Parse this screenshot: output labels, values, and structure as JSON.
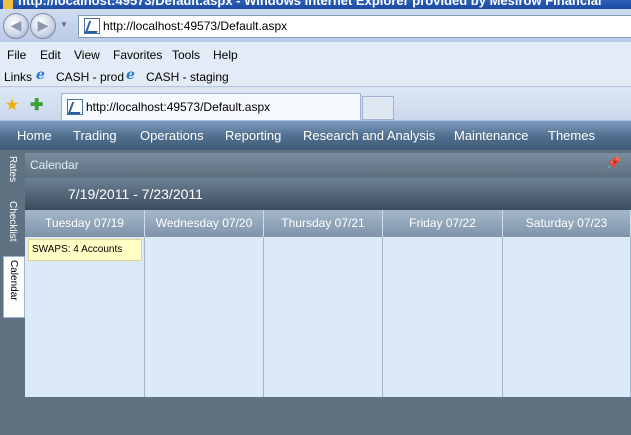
{
  "window": {
    "title": "http://localhost:49573/Default.aspx - Windows Internet Explorer provided by Mesirow Financial"
  },
  "browser": {
    "address": "http://localhost:49573/Default.aspx",
    "menu": {
      "file": "File",
      "edit": "Edit",
      "view": "View",
      "favorites": "Favorites",
      "tools": "Tools",
      "help": "Help"
    },
    "links": {
      "label": "Links",
      "items": [
        "CASH - prod",
        "CASH - staging"
      ]
    },
    "tab": {
      "title": "http://localhost:49573/Default.aspx"
    }
  },
  "app": {
    "nav": [
      "Home",
      "Trading",
      "Operations",
      "Reporting",
      "Research and Analysis",
      "Maintenance",
      "Themes"
    ],
    "side_tabs": [
      "Rates",
      "Checklist",
      "Calendar"
    ],
    "panel_title": "Calendar",
    "calendar": {
      "range": "7/19/2011 - 7/23/2011",
      "days": [
        "Tuesday 07/19",
        "Wednesday 07/20",
        "Thursday 07/21",
        "Friday 07/22",
        "Saturday 07/23"
      ],
      "appointment": "SWAPS: 4 Accounts"
    }
  },
  "colors": {
    "nav_bg": "#52708f",
    "cal_body": "#dce9f6",
    "appointment_bg": "#ffffc6"
  }
}
